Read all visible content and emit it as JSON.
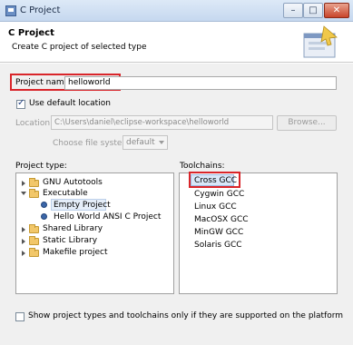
{
  "window": {
    "title": "C Project",
    "min_glyph": "–",
    "max_glyph": "□",
    "close_glyph": "✕"
  },
  "header": {
    "title": "C Project",
    "description": "Create C project of selected type"
  },
  "form": {
    "project_name_label": "Project name:",
    "project_name_value": "helloworld",
    "use_default_location_label": "Use default location",
    "use_default_location_checked": true,
    "location_label": "Location:",
    "location_value": "C:\\Users\\daniel\\eclipse-workspace\\helloworld",
    "browse_label": "Browse...",
    "file_system_label": "Choose file system:",
    "file_system_value": "default"
  },
  "project_types": {
    "label": "Project type:",
    "items": [
      {
        "label": "GNU Autotools",
        "expanded": false
      },
      {
        "label": "Executable",
        "expanded": true
      },
      {
        "label": "Empty Project",
        "child": true,
        "highlighted": true
      },
      {
        "label": "Hello World ANSI C Project",
        "child": true
      },
      {
        "label": "Shared Library",
        "expanded": false
      },
      {
        "label": "Static Library",
        "expanded": false
      },
      {
        "label": "Makefile project",
        "expanded": false
      }
    ]
  },
  "toolchains": {
    "label": "Toolchains:",
    "items": [
      "Cross GCC",
      "Cygwin GCC",
      "Linux GCC",
      "MacOSX GCC",
      "MinGW GCC",
      "Solaris GCC"
    ],
    "selected": "Cross GCC"
  },
  "filter": {
    "label": "Show project types and toolchains only if they are supported on the platform",
    "checked": false
  },
  "colors": {
    "highlight_box": "#d9252a",
    "accent": "#3b66a8",
    "selection": "#d9e7f8"
  }
}
